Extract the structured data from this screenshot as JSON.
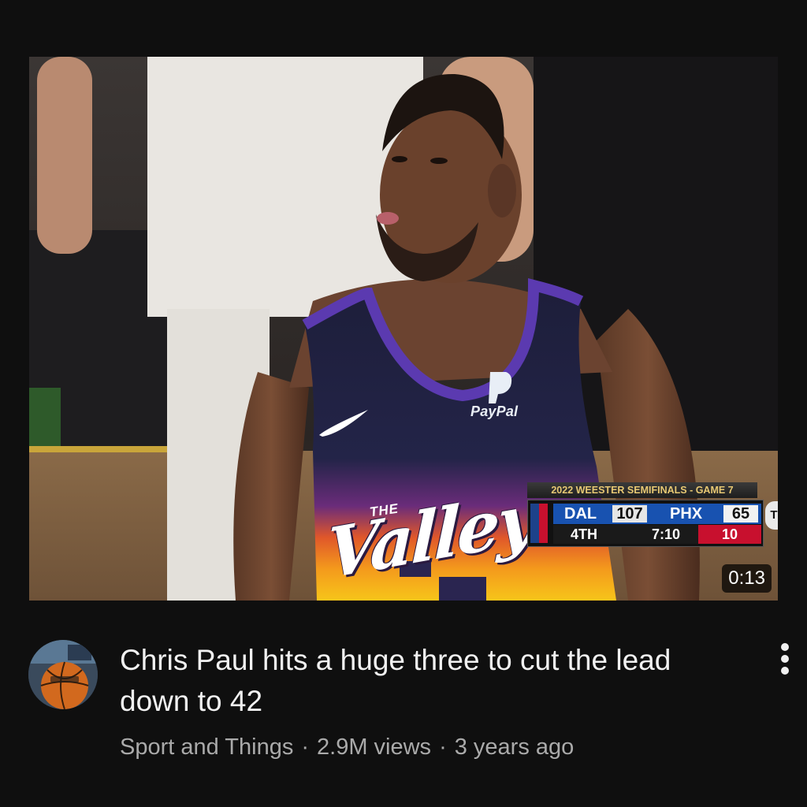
{
  "video": {
    "title": "Chris Paul hits a huge three to cut the lead down to 42",
    "channel": "Sport and Things",
    "views": "2.9M views",
    "age": "3 years ago",
    "separator": "·",
    "duration": "0:13",
    "more_icon": "more-vertical-icon"
  },
  "thumbnail": {
    "jersey_sponsor": "PayPal",
    "jersey_the": "THE",
    "jersey_wordmark": "Valley",
    "scorebug": {
      "title": "2022 WEESTER SEMIFINALS - GAME 7",
      "away_team": "DAL",
      "away_score": "107",
      "home_team": "PHX",
      "home_score": "65",
      "period": "4TH",
      "clock": "7:10",
      "shot_clock": "10",
      "network_icon": "tnt-logo-icon",
      "league_icon": "nba-logo-icon"
    }
  },
  "colors": {
    "background": "#0f0f0f",
    "title_text": "#f1f1f1",
    "meta_text": "#aaaaaa",
    "scorebug_blue": "#1852b0",
    "scorebug_red": "#c8102e",
    "scorebug_gold": "#e7c873"
  }
}
